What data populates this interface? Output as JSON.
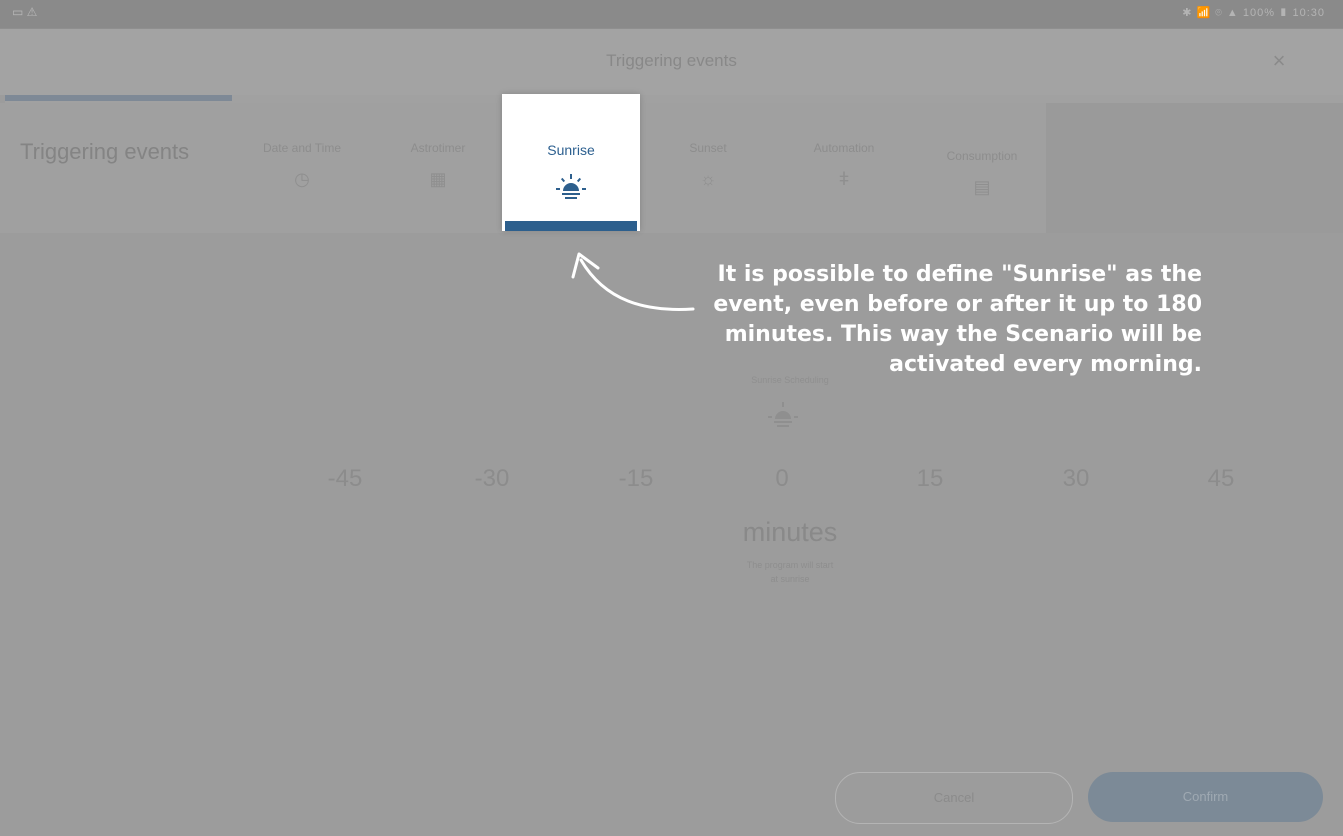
{
  "status_bar": {
    "left_icons": "▭ ⚠",
    "right_text": "✱ 📶 ⌾ ▲ 100% ▮ 10:30"
  },
  "header": {
    "title": "Triggering events",
    "close_icon": "close-icon",
    "close_glyph": "×"
  },
  "progress": {
    "fraction": 0.17
  },
  "events_panel": {
    "label": "Triggering events",
    "tabs": [
      {
        "label": "Date and Time",
        "icon": "clock-icon",
        "glyph": "◷"
      },
      {
        "label": "Astrotimer",
        "icon": "calendar-icon",
        "glyph": "▦"
      },
      {
        "label": "Sunrise",
        "icon": "sunrise-icon",
        "glyph": ""
      },
      {
        "label": "Sunset",
        "icon": "sunset-icon",
        "glyph": "☼"
      },
      {
        "label": "Automation",
        "icon": "automation-icon",
        "glyph": "ǂ"
      },
      {
        "label": "Consumption",
        "icon": "consumption-icon",
        "glyph": "▤"
      }
    ]
  },
  "selected_card": {
    "label": "Sunrise",
    "icon": "sunrise-icon",
    "accent": "#2d5f8d"
  },
  "annotation": {
    "lines": [
      "It is possible to define \"Sunrise\" as the",
      "event, even before or after it up to 180",
      "minutes. This way the Scenario will be",
      "activated every morning."
    ]
  },
  "offset_picker": {
    "caption": "Sunrise Scheduling",
    "icon": "sunrise-icon",
    "values": [
      "-45",
      "-30",
      "-15",
      "0",
      "15",
      "30",
      "45"
    ],
    "unit": "minutes",
    "helper_line1": "The program will start",
    "helper_line2": "at sunrise"
  },
  "buttons": {
    "cancel": "Cancel",
    "confirm": "Confirm"
  },
  "colors": {
    "overlay": "#9c9c9c",
    "accent": "#2d5f8d",
    "annotation_text": "#ffffff"
  }
}
